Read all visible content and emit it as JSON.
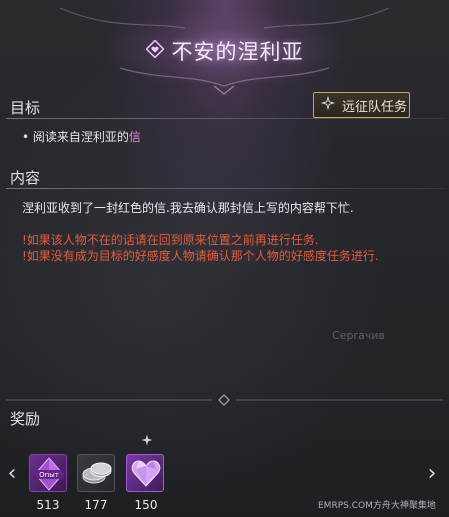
{
  "header": {
    "title": "不安的涅利亚",
    "title_icon": "heart-diamond-icon"
  },
  "objective_section": {
    "label": "目标",
    "badge_label": "远征队任务",
    "badge_icon": "expedition-star-icon",
    "bullet": "•",
    "objective_prefix": "阅读来自涅利亚的",
    "objective_highlight": "信"
  },
  "content_section": {
    "label": "内容",
    "paragraph": "涅利亚收到了一封红色的信.我去确认那封信上写的内容帮下忙.",
    "warnings": [
      "!如果该人物不在的话请在回到原来位置之前再进行任务.",
      "!如果没有成为目标的好感度人物请确认那个人物的好感度任务进行."
    ],
    "faint_text": "Cepraчив"
  },
  "rewards_section": {
    "label": "奖励",
    "items": [
      {
        "name": "exp-crystal",
        "icon_text": "Опыт",
        "count": "513"
      },
      {
        "name": "silver-coins",
        "count": "177"
      },
      {
        "name": "purple-gem-heart",
        "count": "150"
      }
    ],
    "prev_arrow": "‹",
    "next_arrow": "›"
  },
  "footer": {
    "credit": "EMRPS.COM方舟大神聚集地"
  },
  "colors": {
    "highlight": "#e08fe0",
    "warning": "#e85a3a",
    "badge_border": "#c5a866",
    "reward_purple": "#8a3fb0"
  }
}
